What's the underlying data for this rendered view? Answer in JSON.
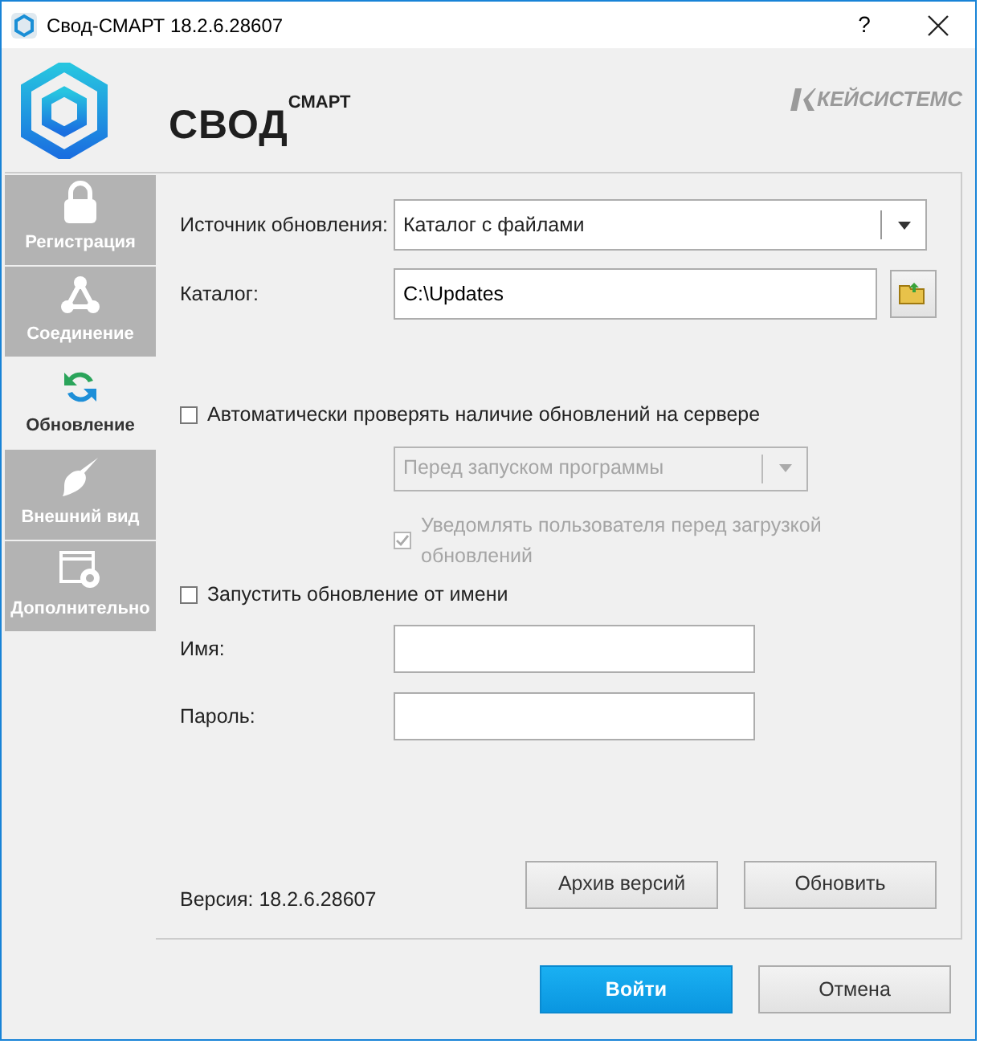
{
  "window": {
    "title": "Свод-СМАРТ 18.2.6.28607",
    "help": "?"
  },
  "header": {
    "logo_text": "СВОД",
    "logo_superscript": "СМАРТ",
    "vendor": "КЕЙСИСТЕМС"
  },
  "tabs": [
    {
      "label": "Регистрация",
      "selected": false
    },
    {
      "label": "Соединение",
      "selected": false
    },
    {
      "label": "Обновление",
      "selected": true
    },
    {
      "label": "Внешний вид",
      "selected": false
    },
    {
      "label": "Дополнительно",
      "selected": false
    }
  ],
  "form": {
    "source": {
      "label": "Источник обновления:",
      "value": "Каталог с файлами"
    },
    "catalog": {
      "label": "Каталог:",
      "value": "C:\\Updates"
    },
    "auto_check": {
      "label": "Автоматически проверять наличие обновлений на сервере",
      "checked": false
    },
    "schedule": {
      "value": "Перед запуском программы",
      "disabled": true
    },
    "notify": {
      "label": "Уведомлять пользователя перед загрузкой обновлений",
      "checked": true,
      "disabled": true
    },
    "run_as": {
      "label": "Запустить обновление от имени",
      "checked": false
    },
    "username": {
      "label": "Имя:"
    },
    "password": {
      "label": "Пароль:"
    }
  },
  "version": "Версия: 18.2.6.28607",
  "panel_buttons": [
    "Архив версий",
    "Обновить"
  ],
  "buttons": [
    {
      "label": "Войти",
      "primary": true
    },
    {
      "label": "Отмена",
      "primary": false
    }
  ]
}
